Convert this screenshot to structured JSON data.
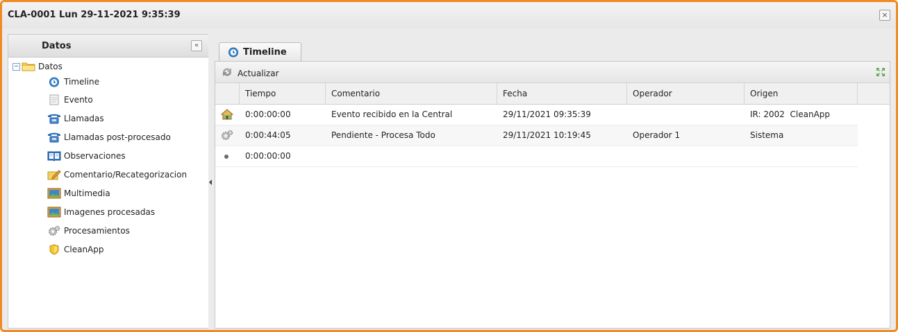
{
  "window": {
    "title": "CLA-0001 Lun 29-11-2021 9:35:39",
    "close_label": "×",
    "accent_color": "#f08a24"
  },
  "left_panel": {
    "title": "Datos",
    "collapse_label": "«",
    "tree": {
      "root": {
        "label": "Datos",
        "toggle": "−",
        "icon": "folder-icon"
      },
      "items": [
        {
          "label": "Timeline",
          "icon": "timeline-icon"
        },
        {
          "label": "Evento",
          "icon": "document-icon"
        },
        {
          "label": "Llamadas",
          "icon": "phone-icon"
        },
        {
          "label": "Llamadas post-procesado",
          "icon": "phone-icon"
        },
        {
          "label": "Observaciones",
          "icon": "book-icon"
        },
        {
          "label": "Comentario/Recategorizacion",
          "icon": "pencil-note-icon"
        },
        {
          "label": "Multimedia",
          "icon": "image-icon"
        },
        {
          "label": "Imagenes procesadas",
          "icon": "image-icon"
        },
        {
          "label": "Procesamientos",
          "icon": "gears-icon"
        },
        {
          "label": "CleanApp",
          "icon": "shield-icon"
        }
      ]
    }
  },
  "main": {
    "tab_label": "Timeline",
    "toolbar": {
      "refresh_label": "Actualizar"
    },
    "table": {
      "columns": [
        "Tiempo",
        "Comentario",
        "Fecha",
        "Operador",
        "Origen"
      ],
      "rows": [
        {
          "icon": "home-icon",
          "tiempo": "0:00:00:00",
          "comentario": "Evento recibido en la Central",
          "fecha": "29/11/2021 09:35:39",
          "operador": "",
          "origen": "IR: 2002  CleanApp"
        },
        {
          "icon": "gears-icon",
          "tiempo": "0:00:44:05",
          "comentario": "Pendiente - Procesa Todo",
          "fecha": "29/11/2021 10:19:45",
          "operador": "Operador 1",
          "origen": "Sistema"
        },
        {
          "icon": "dot-icon",
          "tiempo": "0:00:00:00",
          "comentario": "",
          "fecha": "",
          "operador": "",
          "origen": ""
        }
      ]
    }
  }
}
